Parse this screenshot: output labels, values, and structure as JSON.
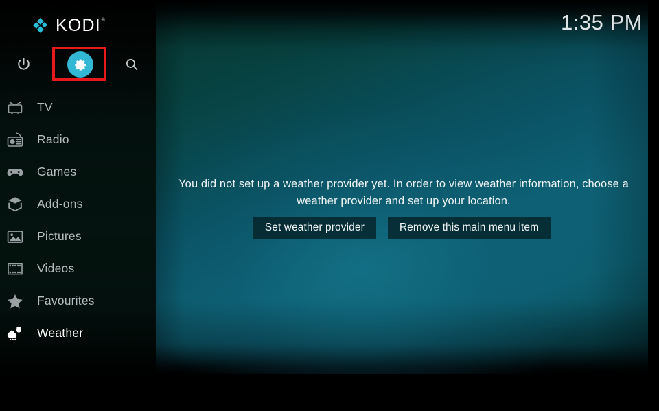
{
  "app": {
    "name": "KODI",
    "logo_icon": "kodi-logo-icon",
    "trademark": "®"
  },
  "clock": {
    "time": "1:35 PM"
  },
  "topbar": {
    "buttons": [
      {
        "name": "power",
        "icon": "power-icon",
        "label": "Power"
      },
      {
        "name": "settings",
        "icon": "gear-icon",
        "label": "Settings",
        "selected": true
      },
      {
        "name": "search",
        "icon": "search-icon",
        "label": "Search"
      }
    ],
    "highlight_color": "#e8191c",
    "settings_circle_color": "#32b8d4"
  },
  "sidebar": {
    "items": [
      {
        "label": "TV",
        "icon": "tv-icon",
        "selected": false
      },
      {
        "label": "Radio",
        "icon": "radio-icon",
        "selected": false
      },
      {
        "label": "Games",
        "icon": "gamepad-icon",
        "selected": false
      },
      {
        "label": "Add-ons",
        "icon": "addons-box-icon",
        "selected": false
      },
      {
        "label": "Pictures",
        "icon": "picture-icon",
        "selected": false
      },
      {
        "label": "Videos",
        "icon": "filmstrip-icon",
        "selected": false
      },
      {
        "label": "Favourites",
        "icon": "star-icon",
        "selected": false
      },
      {
        "label": "Weather",
        "icon": "weather-icon",
        "selected": true
      }
    ]
  },
  "main": {
    "message": "You did not set up a weather provider yet. In order to view weather information, choose a weather provider and set up your location.",
    "buttons": [
      {
        "label": "Set weather provider"
      },
      {
        "label": "Remove this main menu item"
      }
    ]
  }
}
